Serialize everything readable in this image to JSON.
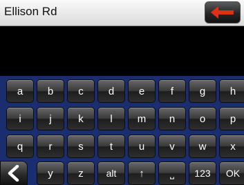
{
  "input": {
    "value": "Ellison Rd"
  },
  "backspace": {
    "icon": "left-arrow-icon",
    "color": "#e03018"
  },
  "back": {
    "icon": "chevron-left-icon"
  },
  "colors": {
    "keyboard_bg": "#1a2d6e",
    "key_text": "#ffffff",
    "input_bg": "#efefef"
  },
  "keyboard": {
    "rows": [
      [
        "a",
        "b",
        "c",
        "d",
        "e",
        "f",
        "g",
        "h"
      ],
      [
        "i",
        "j",
        "k",
        "l",
        "m",
        "n",
        "o",
        "p"
      ],
      [
        "q",
        "r",
        "s",
        "t",
        "u",
        "v",
        "w",
        "x"
      ],
      [
        "y",
        "z",
        "alt",
        "↑",
        "⎵",
        "123",
        "OK"
      ]
    ]
  }
}
